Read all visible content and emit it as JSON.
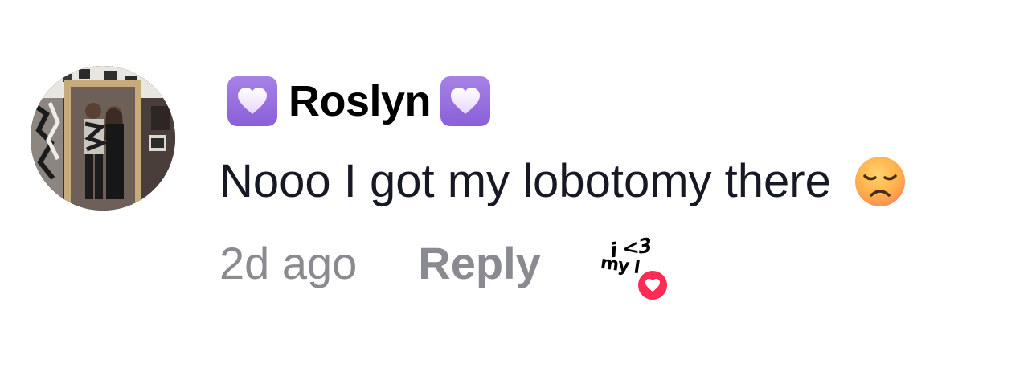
{
  "comment": {
    "username": "Roslyn",
    "username_prefix_icon": "purple-heart-emoji",
    "username_suffix_icon": "purple-heart-emoji",
    "text": "Nooo I got my lobotomy there",
    "text_emoji": "disappointed-face-emoji",
    "timestamp": "2d ago",
    "reply_label": "Reply",
    "creator_like": {
      "sticker_text_line1": "i <3",
      "sticker_text_line2": "my l",
      "badge_icon": "heart-icon"
    }
  },
  "colors": {
    "text_primary": "#161823",
    "text_secondary": "#8a8b91",
    "heart_badge": "#fe2c55",
    "purple_badge": "#8a5fd8"
  }
}
